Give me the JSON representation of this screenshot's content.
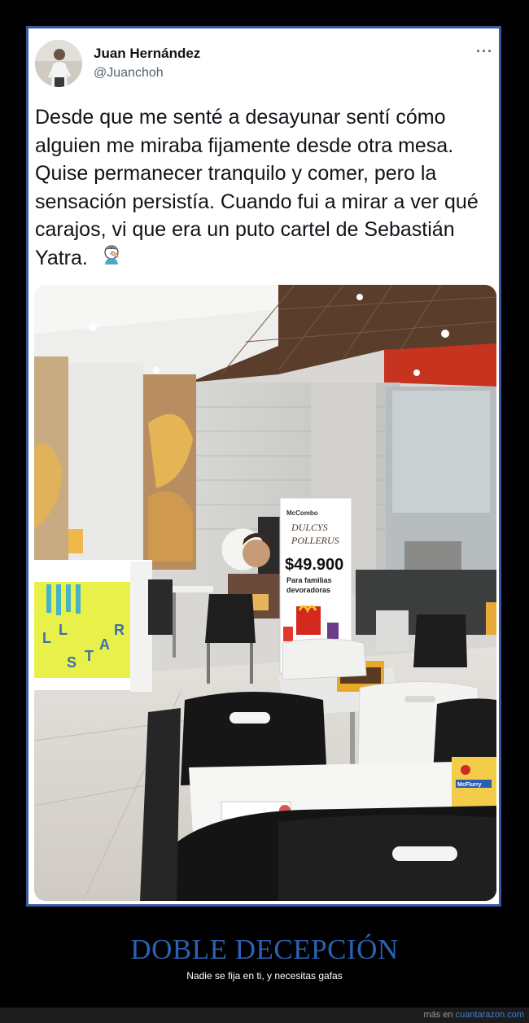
{
  "tweet": {
    "author_name": "Juan Hernández",
    "author_handle": "@Juanchoh",
    "more_icon": "more-horizontal-icon",
    "text": "Desde que me senté a desayunar sentí cómo alguien me miraba fijamente desde otra mesa. Quise permanecer tranquilo y comer, pero la sensación persistía. Cuando fui a mirar a ver qué carajos, vi que era un puto cartel de Sebastián Yatra.",
    "emoji_icon": "man-facepalming-icon"
  },
  "photo": {
    "sign_brand": "McCombo",
    "sign_line1": "DULCYS",
    "sign_line2": "POLLERUS",
    "sign_price": "$49.900",
    "sign_caption1": "Para familias",
    "sign_caption2": "devoradoras",
    "wall_letters": [
      "L",
      "L",
      "S",
      "T",
      "A",
      "R"
    ],
    "box_label": "McFlurry"
  },
  "post": {
    "title": "DOBLE DECEPCIÓN",
    "subtitle": "Nadie se fija en ti, y necesitas gafas"
  },
  "footer": {
    "prefix": "más en",
    "link": "cuantarazon.com"
  },
  "colors": {
    "page_bg": "#000000",
    "frame_border": "#3b57a0",
    "title_blue": "#2a62b3",
    "link_blue": "#3f7fd6"
  }
}
